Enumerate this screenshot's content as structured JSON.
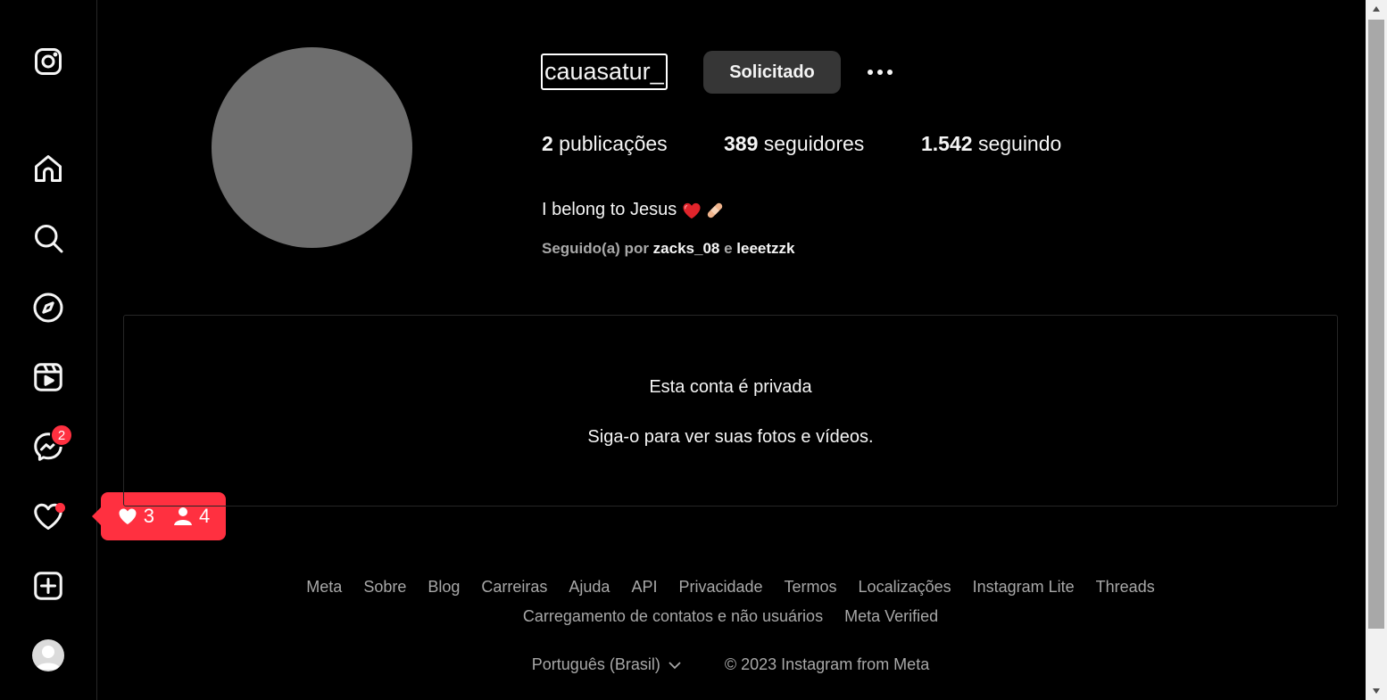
{
  "sidebar": {
    "items": [
      {
        "name": "instagram-logo",
        "label": "Instagram"
      },
      {
        "name": "home",
        "label": "Página inicial"
      },
      {
        "name": "search",
        "label": "Pesquisa"
      },
      {
        "name": "explore",
        "label": "Explorar"
      },
      {
        "name": "reels",
        "label": "Reels"
      },
      {
        "name": "messages",
        "label": "Mensagens",
        "badge": "2"
      },
      {
        "name": "notifications",
        "label": "Notificações"
      },
      {
        "name": "create",
        "label": "Criar"
      },
      {
        "name": "profile",
        "label": "Perfil"
      }
    ],
    "notification_pill": {
      "likes": "3",
      "followers": "4"
    }
  },
  "profile": {
    "username": "cauasatur_",
    "follow_button": "Solicitado",
    "stats": {
      "posts_count": "2",
      "posts_label": " publicações",
      "followers_count": "389",
      "followers_label": " seguidores",
      "following_count": "1.542",
      "following_label": " seguindo"
    },
    "bio": "I belong to Jesus",
    "bio_emojis": [
      "red-heart",
      "adhesive-bandage"
    ],
    "followed_by_prefix": "Seguido(a) por ",
    "followed_by_user1": "zacks_08",
    "followed_by_conj": " e ",
    "followed_by_user2": "leeetzzk"
  },
  "private": {
    "title": "Esta conta é privada",
    "subtitle": "Siga-o para ver suas fotos e vídeos."
  },
  "footer": {
    "links": [
      "Meta",
      "Sobre",
      "Blog",
      "Carreiras",
      "Ajuda",
      "API",
      "Privacidade",
      "Termos",
      "Localizações",
      "Instagram Lite",
      "Threads",
      "Carregamento de contatos e não usuários",
      "Meta Verified"
    ],
    "language": "Português (Brasil)",
    "copyright": "© 2023 Instagram from Meta"
  },
  "colors": {
    "background": "#000000",
    "accent_red": "#ff3040",
    "button_gray": "#363636",
    "avatar_gray": "#6e6e6e",
    "secondary_text": "#a8a8a8"
  }
}
